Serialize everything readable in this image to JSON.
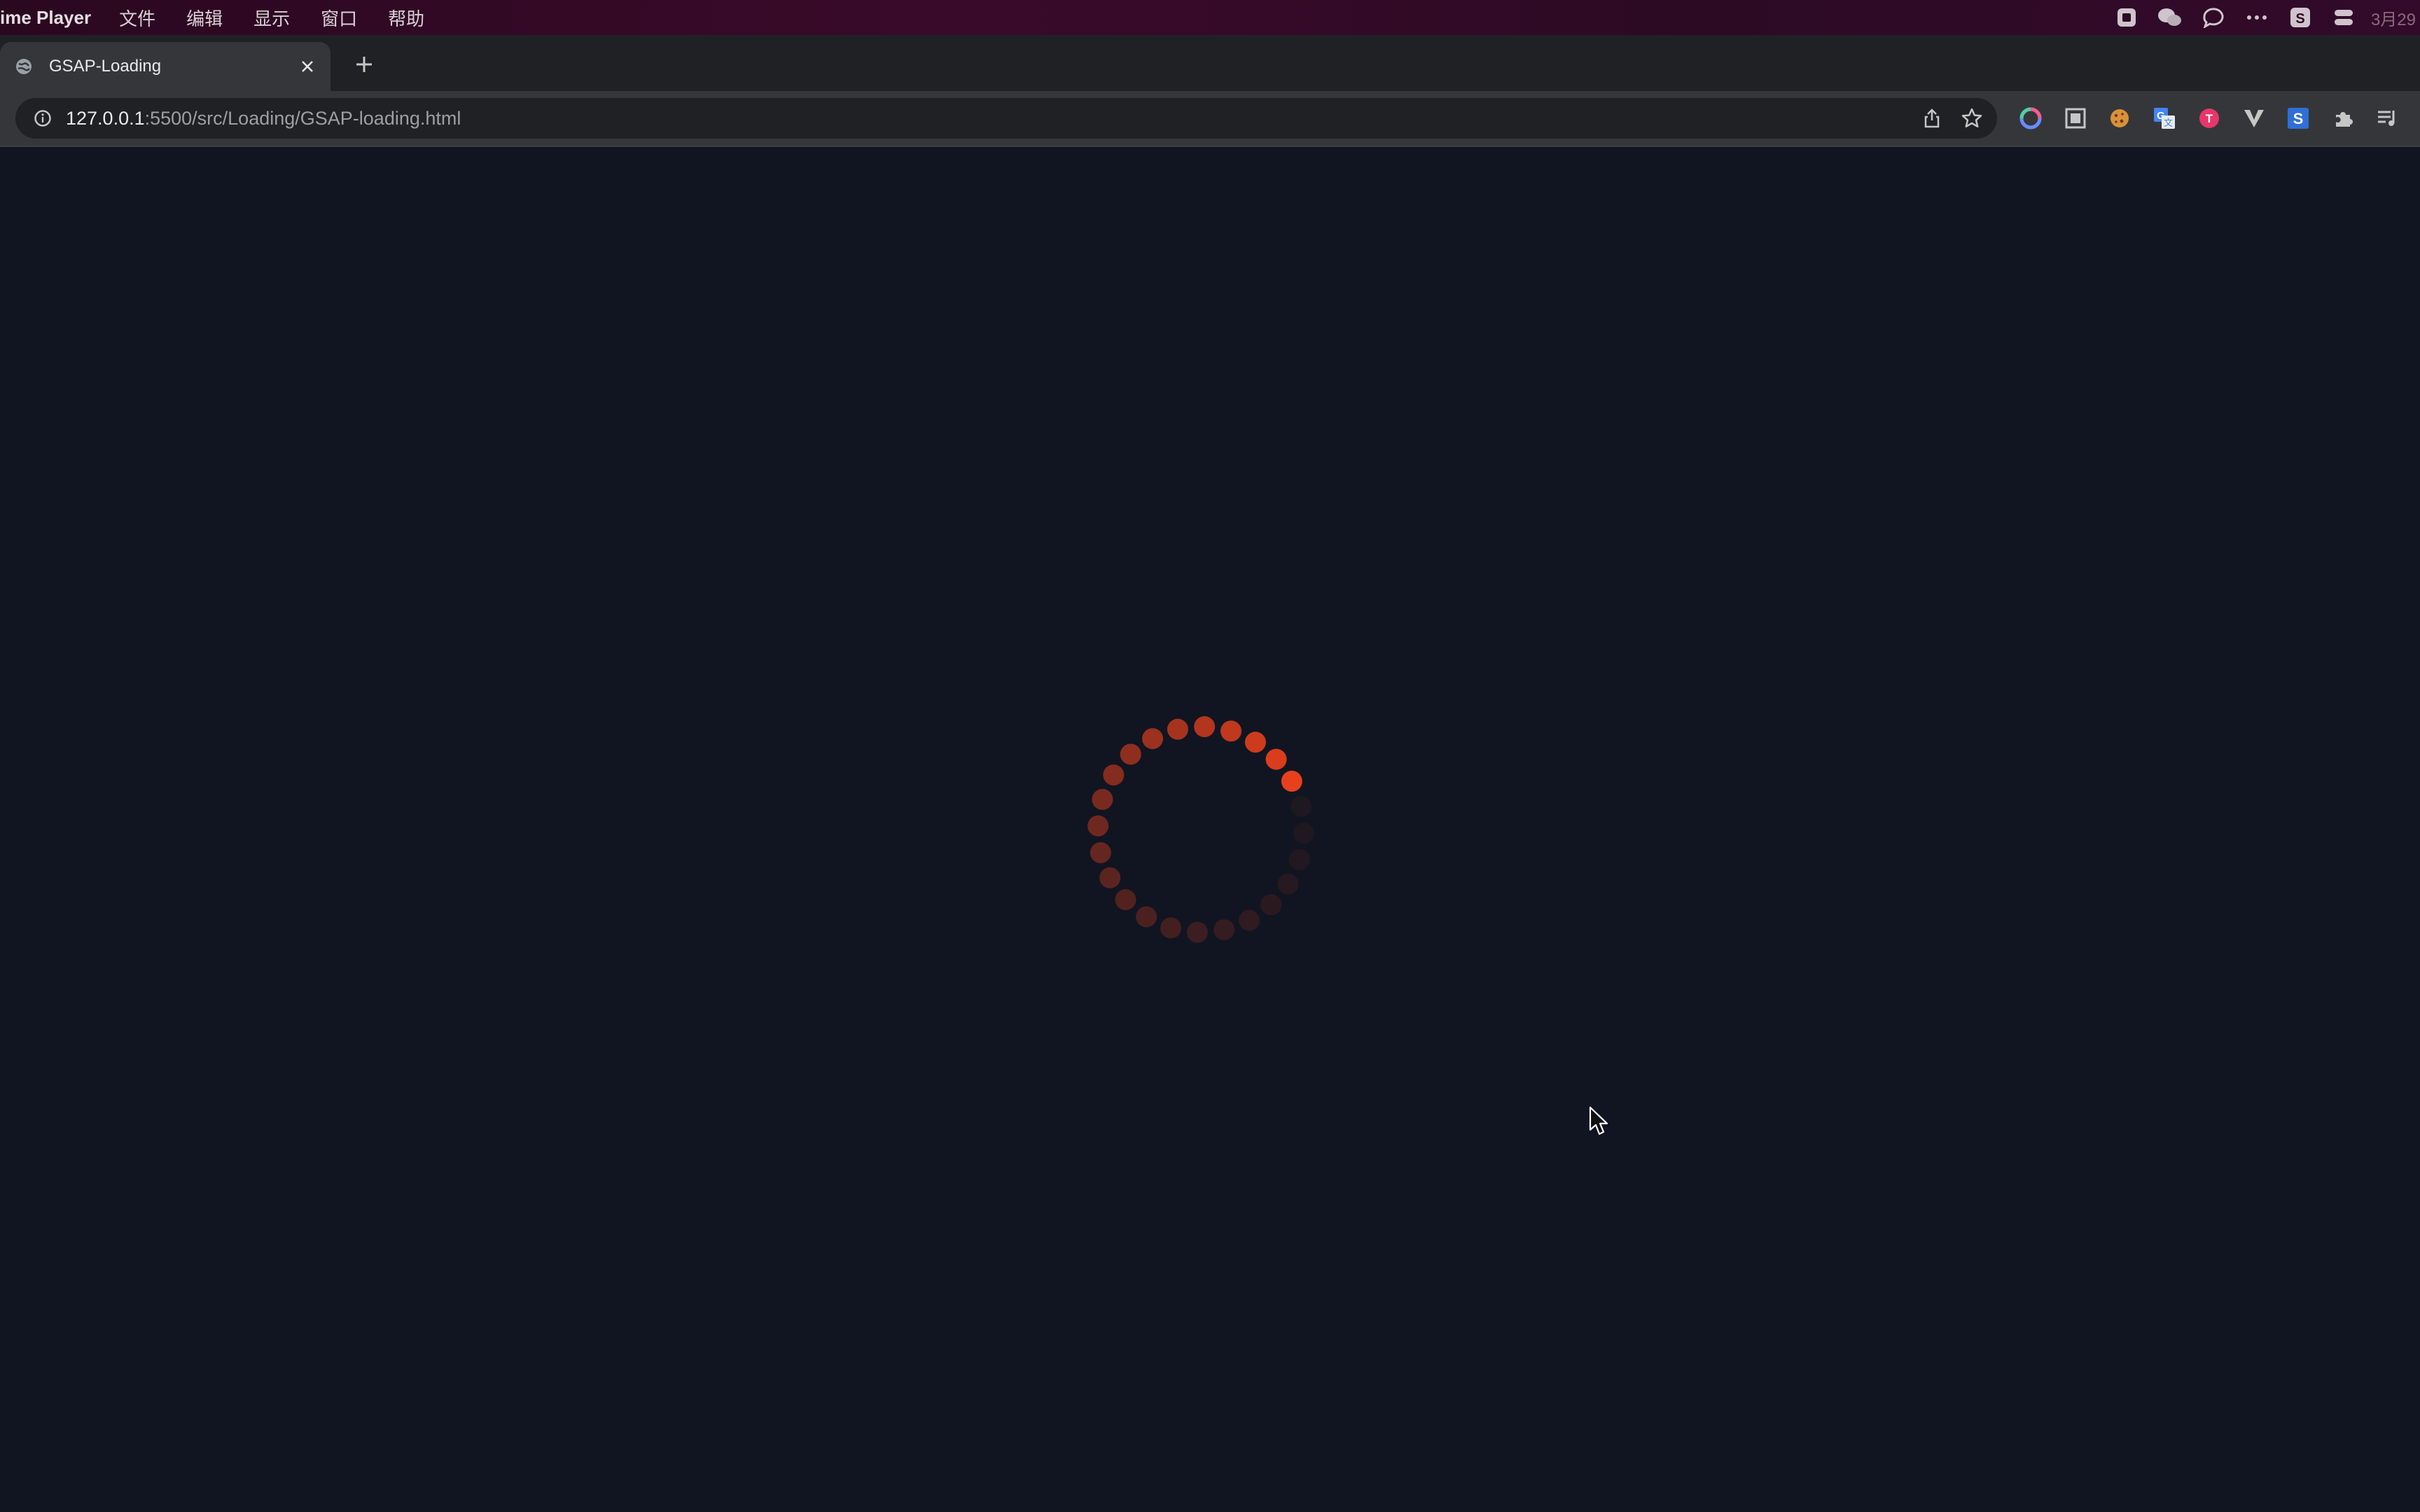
{
  "menubar": {
    "app_name": "ime Player",
    "items": [
      "文件",
      "编辑",
      "显示",
      "窗口",
      "帮助"
    ],
    "tray_icons": [
      "screen-record-icon",
      "wechat-icon",
      "message-icon",
      "more-dots-icon",
      "s-app-icon",
      "control-center-icon"
    ],
    "clock": "3月29"
  },
  "tab": {
    "title": "GSAP-Loading",
    "favicon": "globe-icon"
  },
  "address_bar": {
    "host": "127.0.0.1",
    "path": ":5500/src/Loading/GSAP-loading.html"
  },
  "extensions": [
    "color-circle-icon",
    "square-frame-icon",
    "cookie-icon",
    "translate-icon",
    "red-t-icon",
    "v-logo-icon",
    "s-logo-icon",
    "puzzle-icon",
    "media-list-icon"
  ],
  "spinner": {
    "dot_count": 24,
    "accent_color": "#e8401c"
  },
  "colors": {
    "page_background": "#111521",
    "tab_strip": "#202124",
    "toolbar": "#35363a"
  }
}
